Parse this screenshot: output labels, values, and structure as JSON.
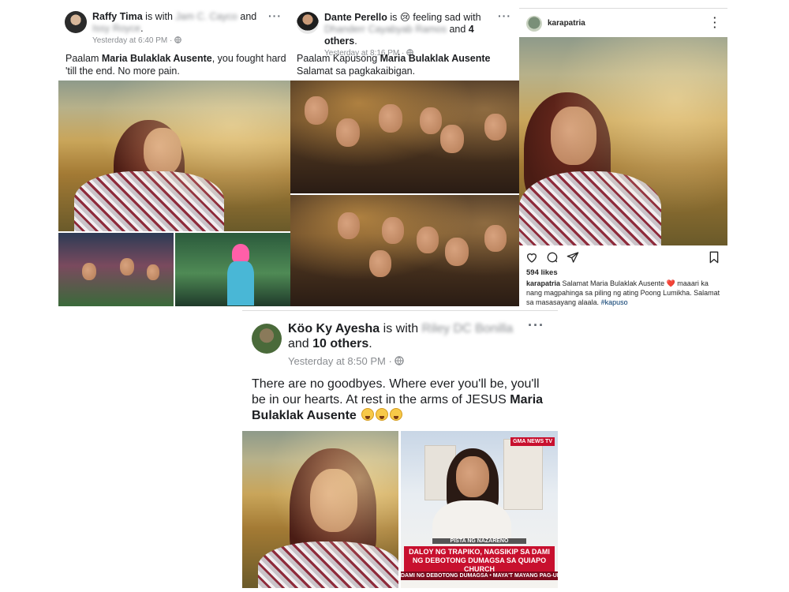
{
  "post1": {
    "author": "Raffy Tima",
    "with_prefix": "is with",
    "tagged1": "Jam C. Cayco",
    "conj": "and",
    "tagged2": "Issy Royce",
    "time": "Yesterday at 6:40 PM",
    "text_pre": "Paalam ",
    "text_bold": "Maria Bulaklak Ausente",
    "text_post": ", you fought hard 'till the end. No more pain."
  },
  "post2": {
    "author": "Dante Perello",
    "feeling": "is 😢 feeling sad with",
    "tagged": "Dhanderr Cayabyab Ramos",
    "conj": "and",
    "others": "4 others",
    "time": "Yesterday at 8:16 PM",
    "text_pre": "Paalam Kapusong ",
    "text_bold": "Maria Bulaklak Ausente",
    "text_post": " Salamat sa pagkakaibigan."
  },
  "post3": {
    "username": "karapatria",
    "likes": "594 likes",
    "caption_user": "karapatria",
    "caption_text": " Salamat Maria Bulaklak Ausente ❤️ maaari ka nang magpahinga sa piling ng ating Poong Lumikha. Salamat sa masasayang alaala. ",
    "hashtag": "#kapuso"
  },
  "post4": {
    "author": "Köo Ky Ayesha",
    "with_prefix": "is with",
    "tagged": "Riley DC Bonilla",
    "conj": "and",
    "others": "10 others",
    "time": "Yesterday at 8:50 PM",
    "text_pre": "There are no goodbyes. Where ever you'll be, you'll be in our hearts. At rest in the arms of JESUS ",
    "text_bold": "Maria Bulaklak Ausente",
    "news_badge": "GMA NEWS TV",
    "news_tag": "PISTA NG NAZARENO",
    "news_headline": "DALOY NG TRAPIKO, NAGSIKIP SA DAMI NG DEBOTONG DUMAGSA SA QUIAPO CHURCH",
    "news_ticker": "DAMI NG DEBOTONG DUMAGSA • MAYA'T MAYANG PAG-ULAN"
  },
  "icons": [
    "globe-icon",
    "more-options-icon",
    "heart-icon",
    "comment-icon",
    "share-icon",
    "bookmark-icon",
    "crying-emoji-icon"
  ],
  "colors": {
    "meta_gray": "#8a8d91",
    "hashtag_blue": "#00376b",
    "heart_red": "#ed4956",
    "news_red": "#c8102e"
  }
}
